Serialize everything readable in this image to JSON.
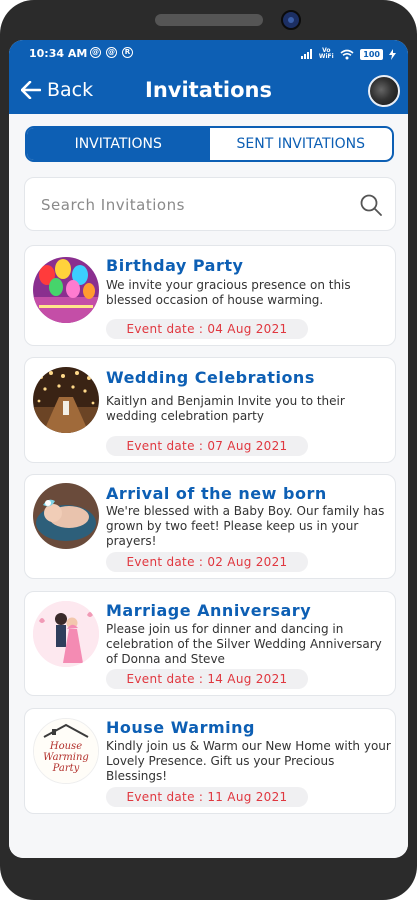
{
  "status_bar": {
    "time": "10:34 AM",
    "network_label": "Vo WiFi",
    "battery": "100"
  },
  "header": {
    "back_label": "Back",
    "title": "Invitations"
  },
  "tabs": [
    {
      "label": "INVITATIONS",
      "active": true
    },
    {
      "label": "SENT INVITATIONS",
      "active": false
    }
  ],
  "search": {
    "placeholder": "Search Invitations",
    "value": ""
  },
  "invitations": [
    {
      "title": "Birthday Party",
      "description": "We invite your gracious presence on this blessed occasion of house warming.",
      "event_date": "Event date : 04 Aug 2021",
      "image": "birthday-balloons"
    },
    {
      "title": "Wedding Celebrations",
      "description": "Kaitlyn and Benjamin Invite you to their wedding celebration party",
      "event_date": "Event date : 07 Aug 2021",
      "image": "wedding-hall-lights"
    },
    {
      "title": "Arrival of the new born",
      "description": "We're blessed with a Baby Boy. Our family has grown by two feet! Please keep us in your prayers!",
      "event_date": "Event date : 02 Aug 2021",
      "image": "newborn-baby"
    },
    {
      "title": "Marriage Anniversary",
      "description": "Please join us for dinner and dancing in celebration of the Silver Wedding Anniversary of Donna and Steve",
      "event_date": "Event date : 14 Aug 2021",
      "image": "couple-illustration"
    },
    {
      "title": "House Warming",
      "description": "Kindly join us & Warm our New Home with your Lovely Presence. Gift us your Precious Blessings!",
      "event_date": "Event date : 11 Aug 2021",
      "image": "house-warming-logo",
      "image_text": "House Warming Party"
    }
  ],
  "colors": {
    "primary": "#0d5fb4",
    "date_text": "#e0373f",
    "date_bg": "#f0f0f2",
    "screen_bg": "#f6f7f9"
  }
}
